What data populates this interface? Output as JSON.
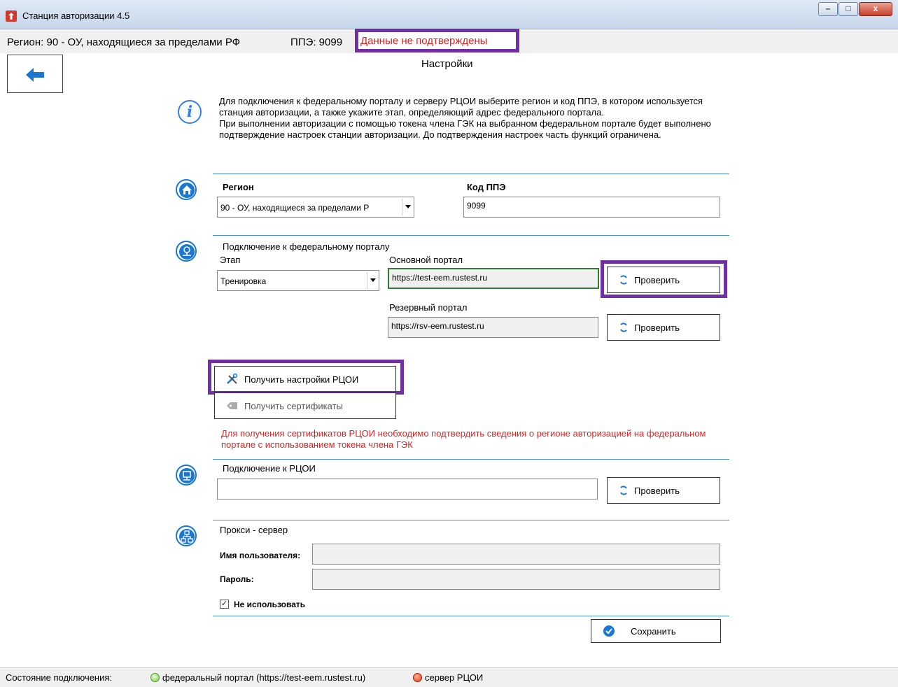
{
  "window": {
    "title": "Станция авторизации 4.5",
    "minimize": "–",
    "maximize": "□",
    "close": "x"
  },
  "status": {
    "region": "Регион: 90 - ОУ, находящиеся за пределами РФ",
    "ppe": "ППЭ: 9099",
    "confirmation": "Данные не подтверждены"
  },
  "page": {
    "title": "Настройки"
  },
  "info": {
    "text1": "Для подключения к федеральному порталу и серверу РЦОИ выберите регион и код ППЭ, в котором используется станция авторизации, а также укажите этап, определяющий адрес федерального портала.",
    "text2": "При выполнении авторизации с помощью токена члена ГЭК на выбранном федеральном портале будет выполнено подтверждение настроек станции авторизации. До подтверждения настроек часть функций ограничена."
  },
  "region": {
    "label": "Регион",
    "value": "90 - ОУ, находящиеся за пределами Р",
    "ppe_label": "Код ППЭ",
    "ppe_value": "9099"
  },
  "portal": {
    "section_label": "Подключение к федеральному порталу",
    "stage_label": "Этап",
    "stage_value": "Тренировка",
    "main_label": "Основной портал",
    "main_value": "https://test-eem.rustest.ru",
    "backup_label": "Резервный портал",
    "backup_value": "https://rsv-eem.rustest.ru",
    "check_label": "Проверить"
  },
  "actions": {
    "get_settings": "Получить настройки РЦОИ",
    "get_certs": "Получить сертификаты",
    "warning": "Для получения сертификатов РЦОИ необходимо подтвердить сведения о регионе авторизацией на федеральном портале с использованием токена члена ГЭК"
  },
  "rcoi": {
    "label": "Подключение к РЦОИ",
    "value": "",
    "check_label": "Проверить"
  },
  "proxy": {
    "label": "Прокси - сервер",
    "user_label": "Имя пользователя:",
    "pass_label": "Пароль:",
    "user_value": "",
    "pass_value": "",
    "not_use_label": "Не использовать",
    "not_use_checked": "✓"
  },
  "save": {
    "label": "Сохранить"
  },
  "footer": {
    "state_label": "Состояние подключения:",
    "portal_status": "федеральный портал (https://test-eem.rustest.ru)",
    "rcoi_status": "сервер РЦОИ"
  },
  "colors": {
    "accent": "#1976d2",
    "highlight": "#7030a0",
    "error": "#e02020",
    "ok": "#4a9a2a"
  }
}
